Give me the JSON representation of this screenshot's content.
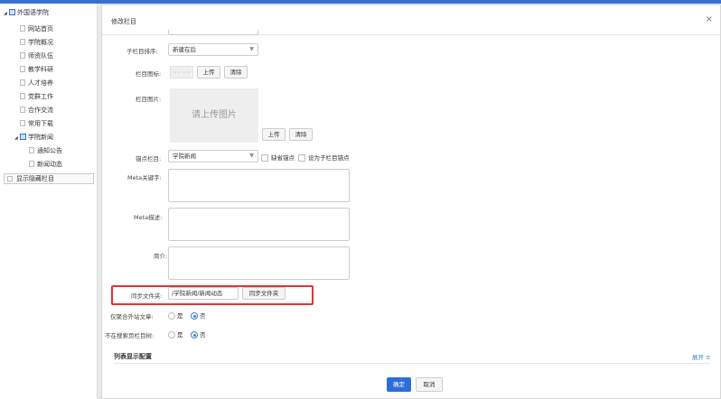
{
  "tree": {
    "root": "外国语学院",
    "items": [
      "网站首页",
      "学院概况",
      "师资队伍",
      "教学科研",
      "人才培养",
      "党群工作",
      "合作交流",
      "常用下载"
    ],
    "news": "学院新闻",
    "news_children": [
      "通知公告",
      "新闻动态"
    ],
    "show_hidden": "显示隐藏栏目"
  },
  "modal": {
    "title": "修改栏目",
    "close": "×"
  },
  "form": {
    "child_order_label": "子栏目排序:",
    "child_order_value": "新建在后",
    "icon_label": "栏目图标:",
    "icon_placeholder": "▭ ▭ ▭ ▭",
    "upload": "上传",
    "clear": "清除",
    "image_label": "栏目图片:",
    "image_placeholder": "请上传图片",
    "anchor_label": "锚点栏目:",
    "anchor_value": "学院新闻",
    "default_anchor": "缺省锚点",
    "set_child_anchor": "设为子栏目锚点",
    "meta_keywords_label": "Meta关键字:",
    "meta_desc_label": "Meta描述:",
    "intro_label": "简介:",
    "sync_folder_label": "同步文件夹:",
    "sync_folder_value": "/学院新闻/新闻动态",
    "sync_folder_button": "同步文件夹",
    "aggregate_label": "仅聚合外站文章:",
    "hide_search_label": "不在搜索页栏目树:",
    "yes": "是",
    "no": "否"
  },
  "list_section": {
    "title": "列表显示配置",
    "expand": "展开 ≡"
  },
  "footer": {
    "ok": "确定",
    "cancel": "取消"
  },
  "colors": {
    "accent": "#2b6fd6",
    "highlight": "#e23232"
  }
}
